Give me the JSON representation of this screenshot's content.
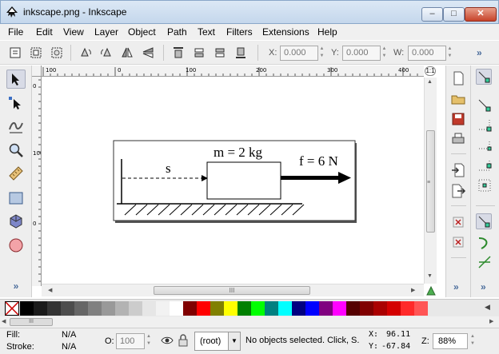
{
  "window": {
    "title": "inkscape.png - Inkscape",
    "minimize": "–",
    "maximize": "□",
    "close": "✕"
  },
  "menu": [
    "File",
    "Edit",
    "View",
    "Layer",
    "Object",
    "Path",
    "Text",
    "Filters",
    "Extensions",
    "Help"
  ],
  "command_bar": {
    "x_label": "X:",
    "x_value": "0.000",
    "y_label": "Y:",
    "y_value": "0.000",
    "w_label": "W:",
    "w_value": "0.000",
    "more": "»"
  },
  "ruler": {
    "top_labels": [
      "100",
      "0",
      "100",
      "200",
      "300",
      "400"
    ],
    "left_labels": [
      "0",
      "100",
      "0"
    ]
  },
  "drawing": {
    "mass_label": "m = 2 kg",
    "force_label": "f = 6 N",
    "displacement_label": "s"
  },
  "scrollbar_grip": "III",
  "palette": {
    "colors": [
      "#000000",
      "#1a1a1a",
      "#333333",
      "#4d4d4d",
      "#666666",
      "#808080",
      "#999999",
      "#b3b3b3",
      "#cccccc",
      "#e6e6e6",
      "#f2f2f2",
      "#ffffff",
      "#800000",
      "#ff0000",
      "#808000",
      "#ffff00",
      "#008000",
      "#00ff00",
      "#008080",
      "#00ffff",
      "#000080",
      "#0000ff",
      "#800080",
      "#ff00ff",
      "#550000",
      "#800000",
      "#aa0000",
      "#d40000",
      "#ff2a2a",
      "#ff5555"
    ]
  },
  "status": {
    "fill_label": "Fill:",
    "fill_value": "N/A",
    "stroke_label": "Stroke:",
    "stroke_value": "N/A",
    "opacity_label": "O:",
    "opacity_value": "100",
    "layer": "(root)",
    "message": "No objects selected. Click, S.",
    "x_label": "X:",
    "x_value": "96.11",
    "y_label": "Y:",
    "y_value": "-67.84",
    "zoom_label": "Z:",
    "zoom_value": "88%"
  }
}
